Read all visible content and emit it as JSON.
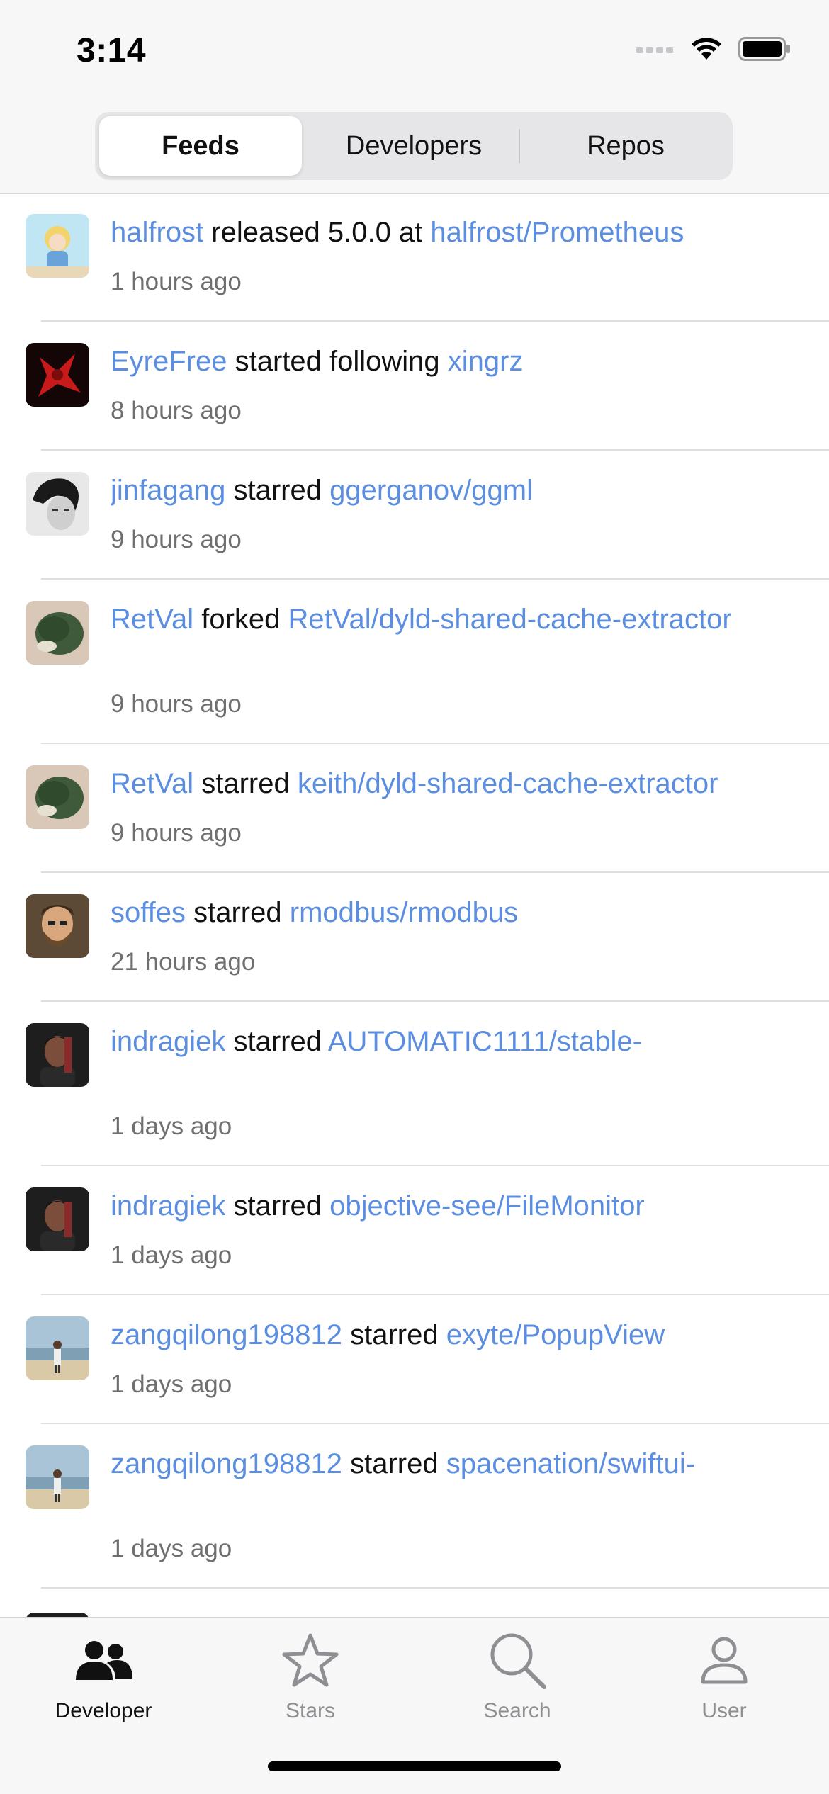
{
  "status_bar": {
    "time": "3:14"
  },
  "segments": [
    {
      "label": "Feeds",
      "selected": true
    },
    {
      "label": "Developers",
      "selected": false
    },
    {
      "label": "Repos",
      "selected": false
    }
  ],
  "feed": [
    {
      "user": "halfrost",
      "action": "released 5.0.0 at",
      "target": "halfrost/Prometheus",
      "time": "1 hours ago",
      "avatar": "illustrated-character-avatar",
      "avatar_color": "#9fd3e6"
    },
    {
      "user": "EyreFree",
      "action": "started following",
      "target": "xingrz",
      "time": "8 hours ago",
      "avatar": "red-figure-avatar",
      "avatar_color": "#c81a1a"
    },
    {
      "user": "jinfagang",
      "action": "starred",
      "target": "ggerganov/ggml",
      "time": "9 hours ago",
      "avatar": "grayscale-face-avatar",
      "avatar_color": "#cfcfcf"
    },
    {
      "user": "RetVal",
      "action": "forked",
      "target": "RetVal/dyld-shared-cache-extractor",
      "time": "9 hours ago",
      "avatar": "pinecone-avatar",
      "avatar_color": "#3f5a3a"
    },
    {
      "user": "RetVal",
      "action": "starred",
      "target": "keith/dyld-shared-cache-extractor",
      "time": "9 hours ago",
      "avatar": "pinecone-avatar",
      "avatar_color": "#3f5a3a"
    },
    {
      "user": "soffes",
      "action": "starred",
      "target": "rmodbus/rmodbus",
      "time": "21 hours ago",
      "avatar": "bearded-man-avatar",
      "avatar_color": "#7a5a3a"
    },
    {
      "user": "indragiek",
      "action": "starred",
      "target": "AUTOMATIC1111/stable-",
      "time": "1 days ago",
      "avatar": "man-portrait-avatar",
      "avatar_color": "#2a2a2a"
    },
    {
      "user": "indragiek",
      "action": "starred",
      "target": "objective-see/FileMonitor",
      "time": "1 days ago",
      "avatar": "man-portrait-avatar",
      "avatar_color": "#2a2a2a"
    },
    {
      "user": "zangqilong198812",
      "action": "starred",
      "target": "exyte/PopupView",
      "time": "1 days ago",
      "avatar": "beach-person-avatar",
      "avatar_color": "#b9c8c9"
    },
    {
      "user": "zangqilong198812",
      "action": "starred",
      "target": "spacenation/swiftui-",
      "time": "1 days ago",
      "avatar": "beach-person-avatar",
      "avatar_color": "#b9c8c9"
    }
  ],
  "tabs": [
    {
      "label": "Developer",
      "icon": "people-icon",
      "active": true
    },
    {
      "label": "Stars",
      "icon": "star-icon",
      "active": false
    },
    {
      "label": "Search",
      "icon": "magnifier-icon",
      "active": false
    },
    {
      "label": "User",
      "icon": "person-icon",
      "active": false
    }
  ],
  "colors": {
    "link": "#5b8ee0",
    "time": "#6f6f6f",
    "tab_inactive": "#8e8e93",
    "tab_active": "#111111"
  }
}
